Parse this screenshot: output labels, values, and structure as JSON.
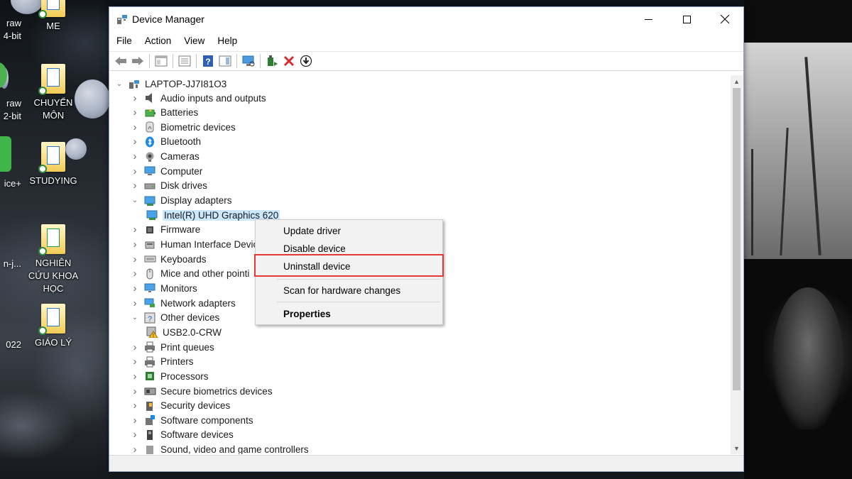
{
  "desktop": {
    "icons": [
      {
        "label": "ME"
      },
      {
        "label": "CHUYỂN MÔN"
      },
      {
        "label": "STUDYING"
      },
      {
        "label": "NGHIÊN CỨU KHOA HỌC"
      },
      {
        "label": "GIÁO LÝ"
      }
    ],
    "left_labels": [
      "raw",
      "4-bit",
      "raw",
      "2-bit",
      "ice+",
      "n-j...",
      "022"
    ]
  },
  "window": {
    "title": "Device Manager",
    "menu": [
      "File",
      "Action",
      "View",
      "Help"
    ],
    "toolbar": [
      "back-icon",
      "forward-icon",
      "properties-view-icon",
      "show-hide-tree-icon",
      "help-icon",
      "action-pane-icon",
      "monitor-scan-icon",
      "update-driver-icon",
      "uninstall-x-icon",
      "download-arrow-icon"
    ],
    "tree": {
      "root": "LAPTOP-JJ7I81O3",
      "items": [
        {
          "label": "Audio inputs and outputs",
          "expanded": false,
          "icon": "speaker-icon"
        },
        {
          "label": "Batteries",
          "expanded": false,
          "icon": "battery-icon"
        },
        {
          "label": "Biometric devices",
          "expanded": false,
          "icon": "fingerprint-icon"
        },
        {
          "label": "Bluetooth",
          "expanded": false,
          "icon": "bluetooth-icon"
        },
        {
          "label": "Cameras",
          "expanded": false,
          "icon": "camera-icon"
        },
        {
          "label": "Computer",
          "expanded": false,
          "icon": "computer-icon"
        },
        {
          "label": "Disk drives",
          "expanded": false,
          "icon": "disk-icon"
        },
        {
          "label": "Display adapters",
          "expanded": true,
          "icon": "display-adapter-icon"
        },
        {
          "label": "Intel(R) UHD Graphics 620",
          "child": true,
          "selected": true,
          "icon": "display-adapter-icon"
        },
        {
          "label": "Firmware",
          "expanded": false,
          "icon": "chip-icon"
        },
        {
          "label": "Human Interface Devic",
          "expanded": false,
          "icon": "hid-icon"
        },
        {
          "label": "Keyboards",
          "expanded": false,
          "icon": "keyboard-icon"
        },
        {
          "label": "Mice and other pointi",
          "expanded": false,
          "icon": "mouse-icon"
        },
        {
          "label": "Monitors",
          "expanded": false,
          "icon": "monitor-icon"
        },
        {
          "label": "Network adapters",
          "expanded": false,
          "icon": "network-icon"
        },
        {
          "label": "Other devices",
          "expanded": true,
          "icon": "unknown-device-icon"
        },
        {
          "label": "USB2.0-CRW",
          "child": true,
          "icon": "warning-device-icon"
        },
        {
          "label": "Print queues",
          "expanded": false,
          "icon": "printer-icon"
        },
        {
          "label": "Printers",
          "expanded": false,
          "icon": "printer-icon"
        },
        {
          "label": "Processors",
          "expanded": false,
          "icon": "processor-icon"
        },
        {
          "label": "Secure biometrics devices",
          "expanded": false,
          "icon": "secure-biometric-icon"
        },
        {
          "label": "Security devices",
          "expanded": false,
          "icon": "security-icon"
        },
        {
          "label": "Software components",
          "expanded": false,
          "icon": "software-component-icon"
        },
        {
          "label": "Software devices",
          "expanded": false,
          "icon": "software-device-icon"
        },
        {
          "label": "Sound, video and game controllers",
          "expanded": false,
          "icon": "sound-icon"
        }
      ]
    },
    "context_menu": {
      "items": [
        "Update driver",
        "Disable device",
        "Uninstall device",
        "Scan for hardware changes",
        "Properties"
      ],
      "highlighted": "Uninstall device",
      "highlight_color": "#e53935"
    }
  }
}
